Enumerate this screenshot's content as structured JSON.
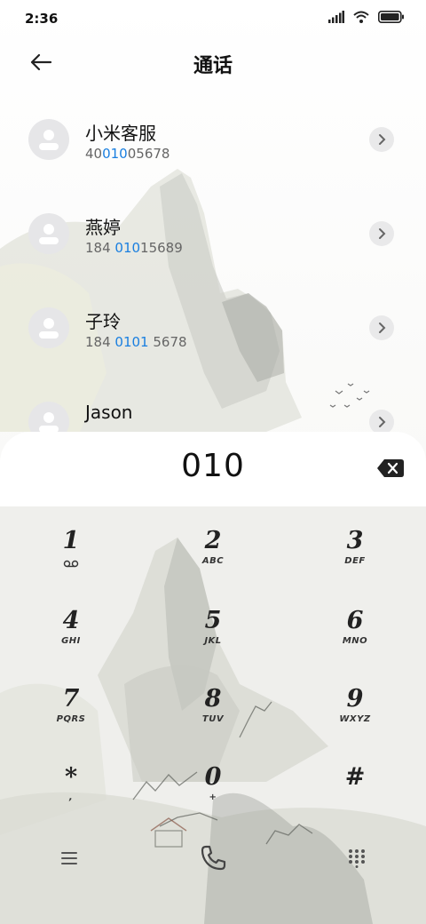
{
  "status": {
    "time": "2:36"
  },
  "header": {
    "title": "通话"
  },
  "contacts": [
    {
      "name": "小米客服",
      "number_pre": "40",
      "number_match": "010",
      "number_post": "05678"
    },
    {
      "name": "燕婷",
      "number_pre": "184 ",
      "number_match": "010",
      "number_post": "15689"
    },
    {
      "name": "子玲",
      "number_pre": "184 ",
      "number_match": "0101",
      "number_post": " 5678"
    },
    {
      "name": "Jason",
      "number_pre": "",
      "number_match": "",
      "number_post": ""
    }
  ],
  "dialer": {
    "display": "010",
    "keys": [
      {
        "digit": "1",
        "letters": ""
      },
      {
        "digit": "2",
        "letters": "ABC"
      },
      {
        "digit": "3",
        "letters": "DEF"
      },
      {
        "digit": "4",
        "letters": "GHI"
      },
      {
        "digit": "5",
        "letters": "JKL"
      },
      {
        "digit": "6",
        "letters": "MNO"
      },
      {
        "digit": "7",
        "letters": "PQRS"
      },
      {
        "digit": "8",
        "letters": "TUV"
      },
      {
        "digit": "9",
        "letters": "WXYZ"
      },
      {
        "digit": "*",
        "letters": ","
      },
      {
        "digit": "0",
        "letters": "+"
      },
      {
        "digit": "#",
        "letters": ""
      }
    ]
  },
  "colors": {
    "accent": "#1a7fe0",
    "call_icon": "#444444"
  },
  "icons": {
    "back": "arrow-left-icon",
    "chevron": "chevron-right-icon",
    "delete": "backspace-icon",
    "menu": "menu-icon",
    "call": "phone-icon",
    "keypad": "dialpad-icon",
    "voicemail": "voicemail-icon"
  }
}
